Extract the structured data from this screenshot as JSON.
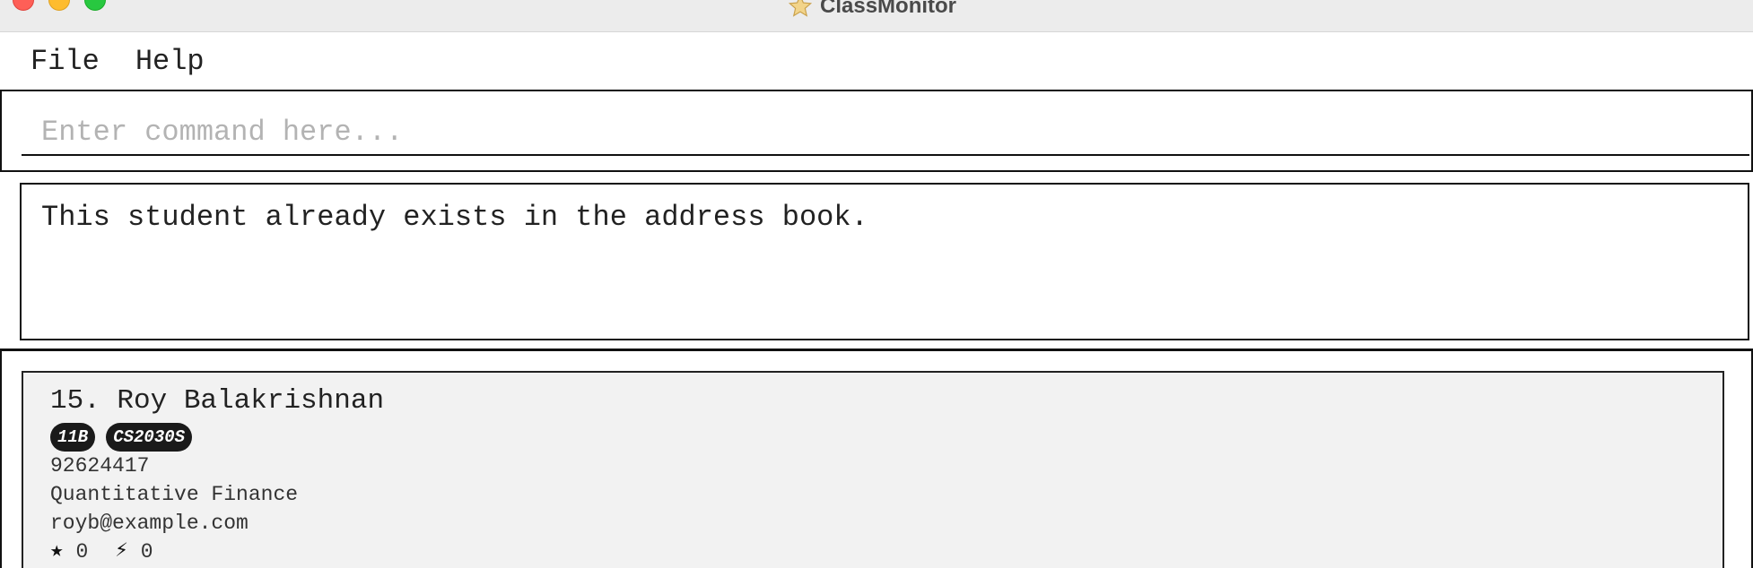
{
  "window": {
    "title": "ClassMonitor",
    "icon": "star-icon"
  },
  "menu": {
    "items": [
      "File",
      "Help"
    ]
  },
  "command": {
    "placeholder": "Enter command here...",
    "value": ""
  },
  "result": {
    "message": "This student already exists in the address book."
  },
  "students": [
    {
      "index": "15.",
      "name": "Roy Balakrishnan",
      "tags": [
        "11B",
        "CS2030S"
      ],
      "phone": "92624417",
      "address": "Quantitative Finance",
      "email": "royb@example.com",
      "stars": "0",
      "bolts": "0"
    }
  ],
  "colors": {
    "tag_bg": "#1a1a1a",
    "card_bg": "#f2f2f2",
    "placeholder": "#b3b3b3",
    "close": "#fe5f57",
    "minimize": "#febc2e",
    "maximize": "#28c840"
  }
}
